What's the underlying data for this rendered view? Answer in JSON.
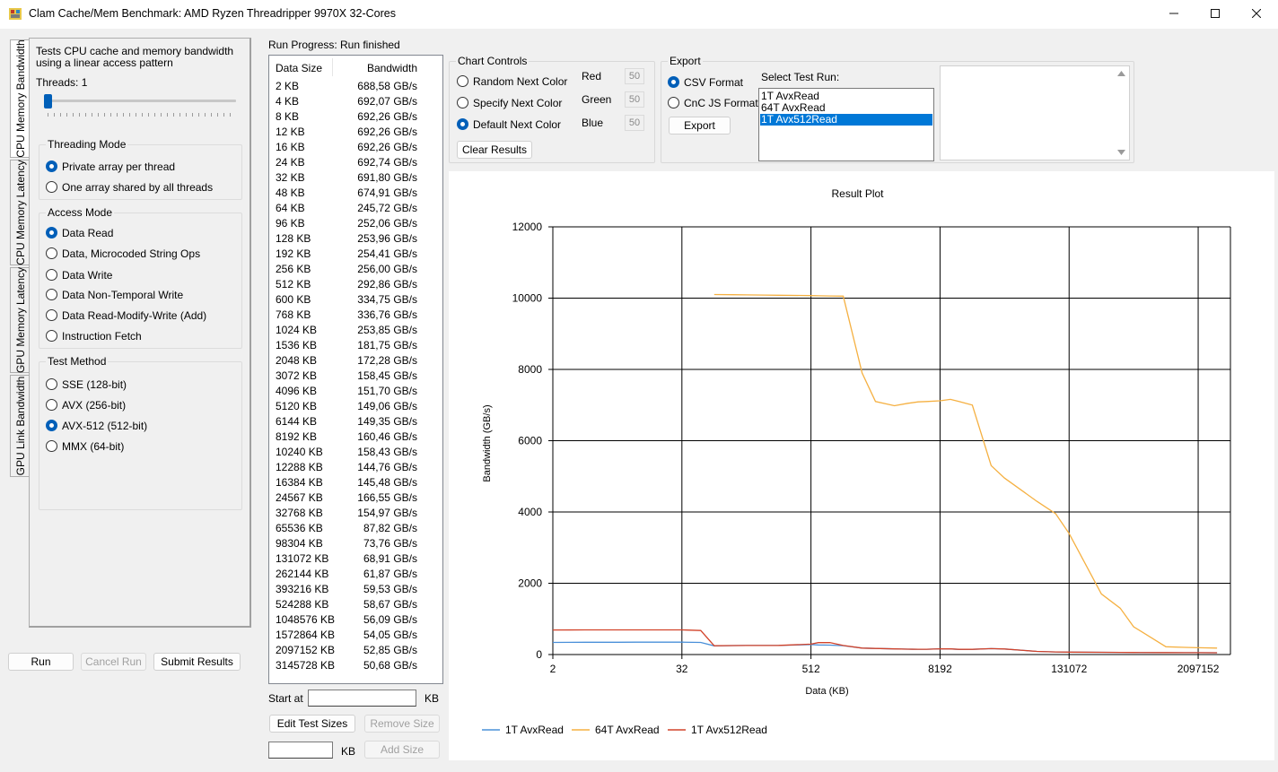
{
  "window": {
    "title": "Clam Cache/Mem Benchmark: AMD Ryzen Threadripper 9970X 32-Cores",
    "minimize": "─",
    "maximize": "☐",
    "close": "✕"
  },
  "tabs": [
    "CPU Memory Bandwidth",
    "CPU Memory Latency",
    "GPU Memory Latency",
    "GPU Link Bandwidth"
  ],
  "left": {
    "description": "Tests CPU cache and memory bandwidth using a linear access pattern",
    "threads_label": "Threads: 1",
    "threading_mode": {
      "title": "Threading Mode",
      "options": [
        "Private array per thread",
        "One array shared by all threads"
      ],
      "selected": 0
    },
    "access_mode": {
      "title": "Access Mode",
      "options": [
        "Data Read",
        "Data, Microcoded String Ops",
        "Data Write",
        "Data Non-Temporal Write",
        "Data Read-Modify-Write (Add)",
        "Instruction Fetch"
      ],
      "selected": 0
    },
    "test_method": {
      "title": "Test Method",
      "options": [
        "SSE (128-bit)",
        "AVX (256-bit)",
        "AVX-512 (512-bit)",
        "MMX (64-bit)"
      ],
      "selected": 2
    },
    "buttons": {
      "run": "Run",
      "cancel": "Cancel Run",
      "submit": "Submit Results"
    }
  },
  "progress": {
    "label": "Run Progress:",
    "status": "Run finished"
  },
  "results_table": {
    "headers": [
      "Data Size",
      "Bandwidth"
    ],
    "rows": [
      [
        "2 KB",
        "688,58 GB/s"
      ],
      [
        "4 KB",
        "692,07 GB/s"
      ],
      [
        "8 KB",
        "692,26 GB/s"
      ],
      [
        "12 KB",
        "692,26 GB/s"
      ],
      [
        "16 KB",
        "692,26 GB/s"
      ],
      [
        "24 KB",
        "692,74 GB/s"
      ],
      [
        "32 KB",
        "691,80 GB/s"
      ],
      [
        "48 KB",
        "674,91 GB/s"
      ],
      [
        "64 KB",
        "245,72 GB/s"
      ],
      [
        "96 KB",
        "252,06 GB/s"
      ],
      [
        "128 KB",
        "253,96 GB/s"
      ],
      [
        "192 KB",
        "254,41 GB/s"
      ],
      [
        "256 KB",
        "256,00 GB/s"
      ],
      [
        "512 KB",
        "292,86 GB/s"
      ],
      [
        "600 KB",
        "334,75 GB/s"
      ],
      [
        "768 KB",
        "336,76 GB/s"
      ],
      [
        "1024 KB",
        "253,85 GB/s"
      ],
      [
        "1536 KB",
        "181,75 GB/s"
      ],
      [
        "2048 KB",
        "172,28 GB/s"
      ],
      [
        "3072 KB",
        "158,45 GB/s"
      ],
      [
        "4096 KB",
        "151,70 GB/s"
      ],
      [
        "5120 KB",
        "149,06 GB/s"
      ],
      [
        "6144 KB",
        "149,35 GB/s"
      ],
      [
        "8192 KB",
        "160,46 GB/s"
      ],
      [
        "10240 KB",
        "158,43 GB/s"
      ],
      [
        "12288 KB",
        "144,76 GB/s"
      ],
      [
        "16384 KB",
        "145,48 GB/s"
      ],
      [
        "24567 KB",
        "166,55 GB/s"
      ],
      [
        "32768 KB",
        "154,97 GB/s"
      ],
      [
        "65536 KB",
        "87,82 GB/s"
      ],
      [
        "98304 KB",
        "73,76 GB/s"
      ],
      [
        "131072 KB",
        "68,91 GB/s"
      ],
      [
        "262144 KB",
        "61,87 GB/s"
      ],
      [
        "393216 KB",
        "59,53 GB/s"
      ],
      [
        "524288 KB",
        "58,67 GB/s"
      ],
      [
        "1048576 KB",
        "56,09 GB/s"
      ],
      [
        "1572864 KB",
        "54,05 GB/s"
      ],
      [
        "2097152 KB",
        "52,85 GB/s"
      ],
      [
        "3145728 KB",
        "50,68 GB/s"
      ]
    ]
  },
  "sizes": {
    "start_at_label": "Start at",
    "start_at_value": "",
    "kb": "KB",
    "edit": "Edit Test Sizes",
    "remove": "Remove Size",
    "add_value": "",
    "add": "Add Size"
  },
  "chart_controls": {
    "title": "Chart Controls",
    "options": [
      "Random Next Color",
      "Specify Next Color",
      "Default Next Color"
    ],
    "selected": 2,
    "red_label": "Red",
    "red": "50",
    "green_label": "Green",
    "green": "50",
    "blue_label": "Blue",
    "blue": "50",
    "clear": "Clear Results"
  },
  "export": {
    "title": "Export",
    "options": [
      "CSV Format",
      "CnC JS Format"
    ],
    "selected": 0,
    "button": "Export",
    "select_label": "Select Test Run:",
    "runs": [
      "1T AvxRead",
      "64T AvxRead",
      "1T Avx512Read"
    ],
    "selected_run": 2
  },
  "chart_data": {
    "type": "line",
    "title": "Result Plot",
    "xlabel": "Data (KB)",
    "ylabel": "Bandwidth (GB/s)",
    "x_scale": "log2",
    "xlim": [
      2,
      4194304
    ],
    "ylim": [
      0,
      12000
    ],
    "x_ticks": [
      "2",
      "32",
      "512",
      "8192",
      "131072",
      "2097152"
    ],
    "y_ticks": [
      "0",
      "2000",
      "4000",
      "6000",
      "8000",
      "10000",
      "12000"
    ],
    "grid": true,
    "legend": "bottom-left",
    "series": [
      {
        "name": "1T AvxRead",
        "color": "#4a90d9",
        "x": [
          2,
          4,
          8,
          12,
          16,
          24,
          32,
          48,
          64,
          96,
          128,
          192,
          256,
          512,
          600,
          768,
          1024,
          1536,
          2048,
          3072,
          4096,
          5120,
          6144,
          8192,
          10240,
          12288,
          16384,
          24567,
          32768,
          65536,
          98304,
          131072,
          262144,
          393216,
          524288,
          1048576,
          1572864,
          2097152,
          3145728
        ],
        "y": [
          340,
          345,
          345,
          346,
          346,
          346,
          347,
          340,
          245,
          251,
          253,
          254,
          255,
          280,
          270,
          265,
          250,
          180,
          171,
          158,
          151,
          149,
          149,
          160,
          158,
          144,
          145,
          166,
          155,
          88,
          74,
          69,
          62,
          60,
          59,
          56,
          54,
          53,
          51
        ]
      },
      {
        "name": "64T AvxRead",
        "color": "#f5b041",
        "x": [
          64,
          96,
          128,
          192,
          256,
          512,
          600,
          768,
          1024,
          1536,
          2048,
          3072,
          4096,
          5120,
          6144,
          8192,
          10240,
          12288,
          16384,
          24567,
          32768,
          65536,
          98304,
          131072,
          262144,
          393216,
          524288,
          1048576,
          1572864,
          2097152,
          3145728
        ],
        "y": [
          10100,
          10095,
          10090,
          10085,
          10080,
          10070,
          10065,
          10060,
          10055,
          7900,
          7100,
          6980,
          7050,
          7090,
          7100,
          7120,
          7160,
          7100,
          7000,
          5300,
          4950,
          4300,
          3950,
          3400,
          1700,
          1300,
          780,
          220,
          200,
          190,
          180
        ]
      },
      {
        "name": "1T Avx512Read",
        "color": "#d2432a",
        "x": [
          2,
          4,
          8,
          12,
          16,
          24,
          32,
          48,
          64,
          96,
          128,
          192,
          256,
          512,
          600,
          768,
          1024,
          1536,
          2048,
          3072,
          4096,
          5120,
          6144,
          8192,
          10240,
          12288,
          16384,
          24567,
          32768,
          65536,
          98304,
          131072,
          262144,
          393216,
          524288,
          1048576,
          1572864,
          2097152,
          3145728
        ],
        "y": [
          689,
          692,
          692,
          692,
          692,
          693,
          692,
          675,
          246,
          252,
          254,
          254,
          256,
          293,
          335,
          337,
          254,
          182,
          172,
          158,
          152,
          149,
          149,
          160,
          158,
          145,
          145,
          167,
          155,
          88,
          74,
          69,
          62,
          60,
          59,
          56,
          54,
          53,
          51
        ]
      }
    ]
  }
}
